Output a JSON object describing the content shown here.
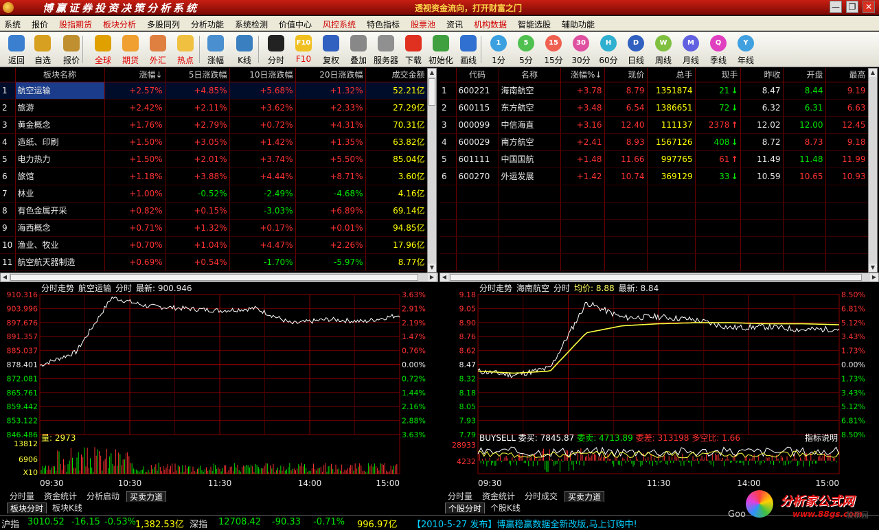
{
  "title": {
    "app": "博赢证券投资决策分析系统",
    "slogan": "透视资金流向，打开财富之门",
    "minimize": "—",
    "restore": "❐",
    "close": "✕"
  },
  "menu": [
    "系统",
    "报价",
    "股指期货",
    "板块分析",
    "多股同列",
    "分析功能",
    "系统检测",
    "价值中心",
    "风控系统",
    "特色指标",
    "股票池",
    "资讯",
    "机构数据",
    "智能选股",
    "辅助功能"
  ],
  "menu_red": [
    2,
    3,
    8,
    10,
    12
  ],
  "toolbar": [
    {
      "label": "返回",
      "icon": "back-icon",
      "color": "#3a7fd0",
      "red": false
    },
    {
      "label": "自选",
      "icon": "star-folder-icon",
      "color": "#d8a020",
      "red": false
    },
    {
      "label": "报价",
      "icon": "quote-icon",
      "color": "#c09030",
      "red": false
    },
    {
      "label": "全球",
      "icon": "globe-icon",
      "color": "#e0a000",
      "red": true
    },
    {
      "label": "期货",
      "icon": "futures-icon",
      "color": "#f0a030",
      "red": true
    },
    {
      "label": "外汇",
      "icon": "forex-icon",
      "color": "#e08040",
      "red": true
    },
    {
      "label": "热点",
      "icon": "hotspot-icon",
      "color": "#f0c040",
      "red": true
    },
    {
      "label": "涨幅",
      "icon": "rank-table-icon",
      "color": "#4a90d0",
      "red": false
    },
    {
      "label": "K线",
      "icon": "kline-icon",
      "color": "#3a80c0",
      "red": false
    },
    {
      "label": "分时",
      "icon": "intraday-icon",
      "color": "#222222",
      "red": false
    },
    {
      "label": "F10",
      "icon": "f10-icon",
      "color": "#f0c020",
      "red": true
    },
    {
      "label": "复权",
      "icon": "restore-right-icon",
      "color": "#3060c0",
      "red": false
    },
    {
      "label": "叠加",
      "icon": "overlay-icon",
      "color": "#888888",
      "red": false
    },
    {
      "label": "服务器",
      "icon": "server-icon",
      "color": "#909090",
      "red": false
    },
    {
      "label": "下载",
      "icon": "download-icon",
      "color": "#e03020",
      "red": false
    },
    {
      "label": "初始化",
      "icon": "home-icon",
      "color": "#40a040",
      "red": false
    },
    {
      "label": "画线",
      "icon": "draw-line-icon",
      "color": "#3070d0",
      "red": false
    },
    {
      "label": "1分",
      "icon": "period-1-icon",
      "color": "#3aa0e0",
      "red": false
    },
    {
      "label": "5分",
      "icon": "period-5-icon",
      "color": "#50c050",
      "red": false
    },
    {
      "label": "15分",
      "icon": "period-15-icon",
      "color": "#f06050",
      "red": false
    },
    {
      "label": "30分",
      "icon": "period-30-icon",
      "color": "#e050a0",
      "red": false
    },
    {
      "label": "60分",
      "icon": "period-60-icon",
      "color": "#30b0d0",
      "red": false
    },
    {
      "label": "日线",
      "icon": "period-day-icon",
      "color": "#3060c0",
      "red": false
    },
    {
      "label": "周线",
      "icon": "period-week-icon",
      "color": "#80c040",
      "red": false
    },
    {
      "label": "月线",
      "icon": "period-month-icon",
      "color": "#6060e0",
      "red": false
    },
    {
      "label": "季线",
      "icon": "period-season-icon",
      "color": "#e040c0",
      "red": false
    },
    {
      "label": "年线",
      "icon": "period-year-icon",
      "color": "#40a0e0",
      "red": false
    }
  ],
  "toolbar_icon_text": [
    "",
    "",
    "",
    "",
    "",
    "",
    "",
    "",
    "",
    "",
    "F10",
    "",
    "",
    "",
    "",
    "",
    "",
    "1",
    "5",
    "15",
    "30",
    "H",
    "D",
    "W",
    "M",
    "Q",
    "Y"
  ],
  "sector_table": {
    "headers": [
      "板块名称",
      "涨幅↓",
      "5日涨跌幅",
      "10日涨跌幅",
      "20日涨跌幅",
      "成交金额"
    ],
    "rows": [
      [
        "1",
        "航空运输",
        "+2.57%",
        "+4.85%",
        "+5.68%",
        "+1.32%",
        "52.21亿"
      ],
      [
        "2",
        "旅游",
        "+2.42%",
        "+2.11%",
        "+3.62%",
        "+2.33%",
        "27.29亿"
      ],
      [
        "3",
        "黄金概念",
        "+1.76%",
        "+2.79%",
        "+0.72%",
        "+4.31%",
        "70.31亿"
      ],
      [
        "4",
        "造纸、印刷",
        "+1.50%",
        "+3.05%",
        "+1.42%",
        "+1.35%",
        "63.82亿"
      ],
      [
        "5",
        "电力热力",
        "+1.50%",
        "+2.01%",
        "+3.74%",
        "+5.50%",
        "85.04亿"
      ],
      [
        "6",
        "旅馆",
        "+1.18%",
        "+3.88%",
        "+4.44%",
        "+8.71%",
        "3.60亿"
      ],
      [
        "7",
        "林业",
        "+1.00%",
        "-0.52%",
        "-2.49%",
        "-4.68%",
        "4.16亿"
      ],
      [
        "8",
        "有色金属开采",
        "+0.82%",
        "+0.15%",
        "-3.03%",
        "+6.89%",
        "69.14亿"
      ],
      [
        "9",
        "海西概念",
        "+0.71%",
        "+1.32%",
        "+0.17%",
        "+0.01%",
        "94.85亿"
      ],
      [
        "10",
        "渔业、牧业",
        "+0.70%",
        "+1.04%",
        "+4.47%",
        "+2.26%",
        "17.96亿"
      ],
      [
        "11",
        "航空航天器制造",
        "+0.69%",
        "+0.54%",
        "-1.70%",
        "-5.97%",
        "8.77亿"
      ]
    ]
  },
  "stock_table": {
    "headers": [
      "",
      "代码",
      "名称",
      "涨幅%↓",
      "现价",
      "总手",
      "现手",
      "昨收",
      "开盘",
      "最高"
    ],
    "rows": [
      [
        "1",
        "600221",
        "海南航空",
        "+3.78",
        "8.79",
        "1351874",
        "21",
        "↓",
        "8.47",
        "8.44",
        "9.19"
      ],
      [
        "2",
        "600115",
        "东方航空",
        "+3.48",
        "6.54",
        "1386651",
        "72",
        "↓",
        "6.32",
        "6.31",
        "6.63"
      ],
      [
        "3",
        "000099",
        "中信海直",
        "+3.16",
        "12.40",
        "111137",
        "2378",
        "↑",
        "12.02",
        "12.00",
        "12.45"
      ],
      [
        "4",
        "600029",
        "南方航空",
        "+2.41",
        "8.93",
        "1567126",
        "408",
        "↓",
        "8.72",
        "8.73",
        "9.18"
      ],
      [
        "5",
        "601111",
        "中国国航",
        "+1.48",
        "11.66",
        "997765",
        "61",
        "↑",
        "11.49",
        "11.48",
        "11.99"
      ],
      [
        "6",
        "600270",
        "外运发展",
        "+1.42",
        "10.74",
        "369129",
        "33",
        "↓",
        "10.59",
        "10.65",
        "10.93"
      ]
    ]
  },
  "left_chart": {
    "header": [
      "分时走势",
      "航空运输",
      "分时",
      "最新: 900.946"
    ],
    "yl": [
      "910.316",
      "903.996",
      "897.676",
      "891.357",
      "885.037",
      "878.401",
      "872.081",
      "865.761",
      "859.442",
      "853.122",
      "846.486"
    ],
    "yr": [
      "3.63%",
      "2.91%",
      "2.19%",
      "1.47%",
      "0.76%",
      "0.00%",
      "0.72%",
      "1.44%",
      "2.16%",
      "2.88%",
      "3.63%"
    ],
    "vol_label": "量: 2973",
    "vol_ticks": [
      "13812",
      "6906",
      "X10"
    ],
    "time": [
      "09:30",
      "10:30",
      "11:30",
      "14:00",
      "15:00"
    ]
  },
  "right_chart": {
    "header": [
      "分时走势",
      "海南航空",
      "分时",
      "均价: 8.88",
      "最新: 8.84"
    ],
    "yl": [
      "9.18",
      "9.05",
      "8.90",
      "8.76",
      "8.62",
      "8.47",
      "8.32",
      "8.18",
      "8.05",
      "7.93",
      "7.79"
    ],
    "yr": [
      "8.50%",
      "6.81%",
      "5.12%",
      "3.43%",
      "1.73%",
      "0.00%",
      "1.73%",
      "3.43%",
      "5.12%",
      "6.81%",
      "8.50%"
    ],
    "ind_header": [
      "BUYSELL 委买: 7845.87",
      "委卖: 4713.89",
      "委差: 313198",
      "多空比: 1.66"
    ],
    "ind_help": "指标说明",
    "ind_ticks": [
      "28933",
      "4232"
    ],
    "time": [
      "09:30",
      "11:30",
      "14:00",
      "15:00"
    ]
  },
  "tabs_left": {
    "row1": [
      "分时量",
      "资金统计",
      "分析启动",
      "买卖力道"
    ],
    "row2": [
      "板块分时",
      "板块K线"
    ]
  },
  "tabs_right": {
    "row1": [
      "分时量",
      "资金统计",
      "分时成交",
      "买卖力道"
    ],
    "row2": [
      "个股分时",
      "个股K线"
    ]
  },
  "status": {
    "sh_name": "沪指",
    "sh_price": "3010.52",
    "sh_chg": "-16.15",
    "sh_pct": "-0.53%",
    "sh_amt": "1,382.53亿",
    "sz_name": "深指",
    "sz_price": "12708.42",
    "sz_chg": "-90.33",
    "sz_pct": "-0.71%",
    "sz_amt": "996.97亿",
    "news": "【2010-5-27 发布】博赢稳赢数据全新改版,马上订购中!"
  },
  "corner": {
    "brand": "分析家公式网",
    "url": "www.88gs.com",
    "bg_text": "Goo",
    "ghost": "股票园"
  },
  "sector_chart_data": {
    "type": "line",
    "x": [
      "09:30",
      "10:30",
      "11:30",
      "14:00",
      "15:00"
    ],
    "title": "航空运输",
    "latest": 900.946,
    "prev_close": 878.401,
    "ylim": [
      846.486,
      910.316
    ],
    "x_values": [
      0.0,
      0.1,
      0.2,
      0.3,
      0.4,
      0.5,
      0.6,
      0.7,
      0.8,
      0.9,
      1.0
    ],
    "y_values": [
      878.0,
      884.0,
      909.0,
      905.0,
      904.0,
      903.0,
      904.0,
      897.0,
      899.0,
      898.0,
      901.0
    ]
  },
  "stock_chart_data": {
    "type": "line",
    "title": "海南航空",
    "latest": 8.84,
    "avg": 8.88,
    "prev_close": 8.47,
    "ylim": [
      7.79,
      9.18
    ],
    "x_values": [
      0.0,
      0.1,
      0.2,
      0.3,
      0.4,
      0.5,
      0.6,
      0.7,
      0.8,
      0.9,
      1.0
    ],
    "y_values": [
      8.42,
      8.38,
      8.45,
      9.1,
      8.95,
      8.96,
      8.93,
      8.85,
      8.86,
      8.83,
      8.84
    ],
    "avg_values": [
      8.42,
      8.4,
      8.42,
      8.8,
      8.87,
      8.89,
      8.9,
      8.9,
      8.89,
      8.89,
      8.88
    ]
  },
  "colors": {
    "up": "#ff3232",
    "down": "#00e600",
    "grid": "#8a0000",
    "accent": "#ffd94a"
  }
}
